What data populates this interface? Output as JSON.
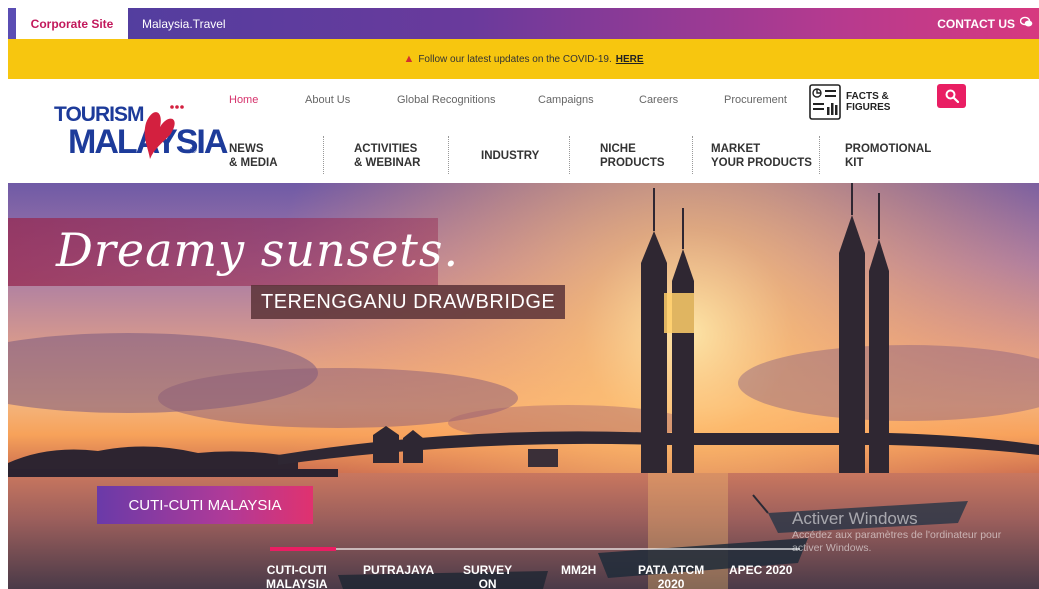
{
  "topbar": {
    "corporate_site": "Corporate Site",
    "malaysia_travel": "Malaysia.Travel",
    "contact_us": "CONTACT US"
  },
  "covid_banner": {
    "text": "Follow our latest updates on the COVID-19.",
    "link": "HERE"
  },
  "logo": {
    "line1": "TOURISM",
    "line2": "MALAYSIA",
    "reg": "®"
  },
  "nav_primary": [
    "Home",
    "About Us",
    "Global Recognitions",
    "Campaigns",
    "Careers",
    "Procurement"
  ],
  "facts": {
    "line1": "FACTS &",
    "line2": "FIGURES"
  },
  "nav_secondary": [
    {
      "l1": "NEWS",
      "l2": "& MEDIA"
    },
    {
      "l1": "ACTIVITIES",
      "l2": "& WEBINAR"
    },
    {
      "l1": "INDUSTRY",
      "l2": ""
    },
    {
      "l1": "NICHE",
      "l2": "PRODUCTS"
    },
    {
      "l1": "MARKET",
      "l2": "YOUR PRODUCTS"
    },
    {
      "l1": "PROMOTIONAL",
      "l2": "KIT"
    }
  ],
  "hero": {
    "headline": "Dreamy sunsets.",
    "subtag": "TERENGGANU DRAWBRIDGE",
    "cta": "CUTI-CUTI MALAYSIA"
  },
  "slides": [
    {
      "l1": "CUTI-CUTI",
      "l2": "MALAYSIA"
    },
    {
      "l1": "PUTRAJAYA",
      "l2": ""
    },
    {
      "l1": "SURVEY",
      "l2": "ON"
    },
    {
      "l1": "MM2H",
      "l2": ""
    },
    {
      "l1": "PATA ATCM",
      "l2": "2020"
    },
    {
      "l1": "APEC 2020",
      "l2": ""
    }
  ],
  "watermark": {
    "title": "Activer Windows",
    "line1": "Accédez aux paramètres de l'ordinateur pour",
    "line2": "activer Windows."
  },
  "colors": {
    "accent": "#e91e63",
    "covid_bar": "#f7c60f",
    "brand_blue": "#1d3b9a"
  }
}
